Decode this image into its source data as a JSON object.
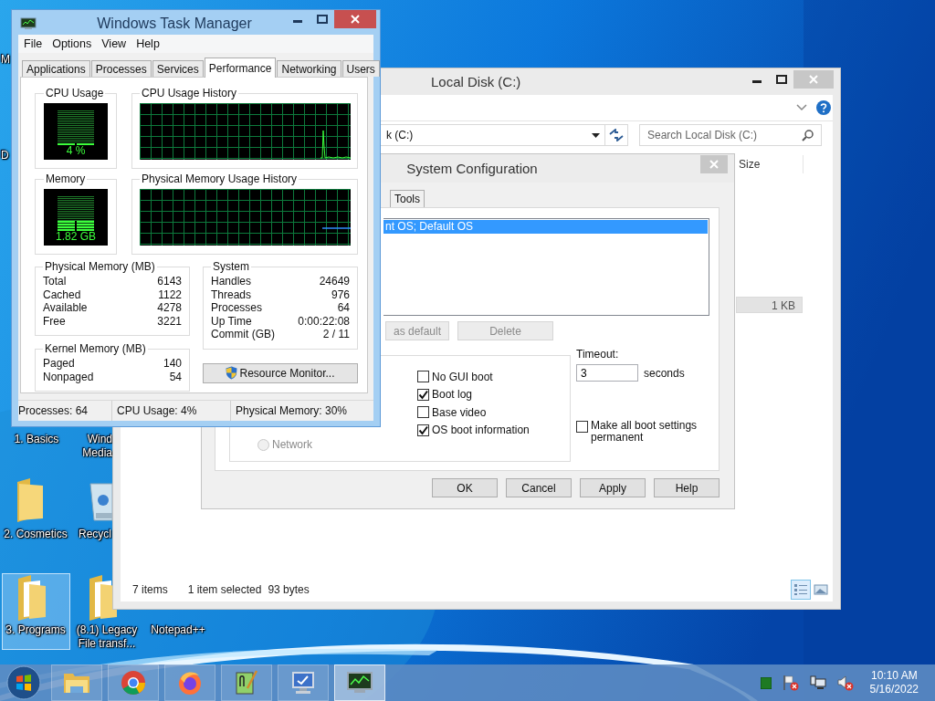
{
  "desktop_icons": [
    {
      "lines": [
        "M"
      ],
      "kind": "none",
      "selected": false
    },
    {
      "lines": [
        "D"
      ],
      "kind": "none",
      "selected": false
    },
    {
      "lines": [
        "1. Basics"
      ],
      "kind": "none",
      "selected": false
    },
    {
      "lines": [
        "Wind",
        "Media"
      ],
      "kind": "none",
      "selected": false
    },
    {
      "lines": [
        "2. Cosmetics"
      ],
      "kind": "folder",
      "selected": false
    },
    {
      "lines": [
        "Recycl"
      ],
      "kind": "recycle-bin",
      "selected": false
    },
    {
      "lines": [
        "3. Programs"
      ],
      "kind": "folder-open",
      "selected": true
    },
    {
      "lines": [
        "(8.1) Legacy",
        "File transf..."
      ],
      "kind": "folder-open",
      "selected": false
    },
    {
      "lines": [
        "Notepad++"
      ],
      "kind": "none",
      "selected": false
    }
  ],
  "explorer": {
    "title": "Local Disk (C:)",
    "address": "k (C:)",
    "search_placeholder": "Search Local Disk (C:)",
    "columns": [
      "Size"
    ],
    "rows": [
      {
        "size": "1 KB",
        "selected": true
      }
    ],
    "status": [
      "7 items",
      "1 item selected",
      "93 bytes"
    ],
    "views": [
      {
        "kind": "details",
        "selected": true
      },
      {
        "kind": "large-icons",
        "selected": false
      }
    ]
  },
  "system_configuration": {
    "title": "System Configuration",
    "tabs": [
      {
        "label": "Tools",
        "selected": false
      }
    ],
    "boot_entries": [
      {
        "label": "nt OS; Default OS",
        "selected": true
      }
    ],
    "entry_buttons": [
      {
        "label": "as default",
        "disabled": true
      },
      {
        "label": "Delete",
        "disabled": true
      }
    ],
    "boot_radios": [
      {
        "label": "Network",
        "selected": false,
        "disabled": true
      }
    ],
    "boot_checkboxes": [
      {
        "label": "No GUI boot",
        "checked": false
      },
      {
        "label": "Boot log",
        "checked": true
      },
      {
        "label": "Base video",
        "checked": false
      },
      {
        "label": "OS boot information",
        "checked": true
      }
    ],
    "timeout": {
      "label": "Timeout:",
      "value": "3",
      "unit": "seconds"
    },
    "make_permanent": {
      "label": "Make all boot settings permanent",
      "checked": false
    },
    "buttons": [
      "OK",
      "Cancel",
      "Apply",
      "Help"
    ]
  },
  "task_manager": {
    "title": "Windows Task Manager",
    "menu": [
      "File",
      "Options",
      "View",
      "Help"
    ],
    "tabs": [
      {
        "label": "Applications",
        "selected": false
      },
      {
        "label": "Processes",
        "selected": false
      },
      {
        "label": "Services",
        "selected": false
      },
      {
        "label": "Performance",
        "selected": true
      },
      {
        "label": "Networking",
        "selected": false
      },
      {
        "label": "Users",
        "selected": false
      }
    ],
    "cpu_usage": {
      "label": "CPU Usage",
      "reading": "4 %"
    },
    "cpu_history": {
      "label": "CPU Usage History"
    },
    "memory": {
      "label": "Memory",
      "reading": "1.82 GB"
    },
    "memory_history": {
      "label": "Physical Memory Usage History"
    },
    "physical_memory": {
      "title": "Physical Memory (MB)",
      "rows": [
        {
          "label": "Total",
          "value": "6143"
        },
        {
          "label": "Cached",
          "value": "1122"
        },
        {
          "label": "Available",
          "value": "4278"
        },
        {
          "label": "Free",
          "value": "3221"
        }
      ]
    },
    "kernel_memory": {
      "title": "Kernel Memory (MB)",
      "rows": [
        {
          "label": "Paged",
          "value": "140"
        },
        {
          "label": "Nonpaged",
          "value": "54"
        }
      ]
    },
    "system": {
      "title": "System",
      "rows": [
        {
          "label": "Handles",
          "value": "24649"
        },
        {
          "label": "Threads",
          "value": "976"
        },
        {
          "label": "Processes",
          "value": "64"
        },
        {
          "label": "Up Time",
          "value": "0:00:22:08"
        },
        {
          "label": "Commit (GB)",
          "value": "2 / 11"
        }
      ]
    },
    "resource_monitor_button": "Resource Monitor...",
    "status_bar": [
      "Processes: 64",
      "CPU Usage: 4%",
      "Physical Memory: 30%"
    ]
  },
  "taskbar": {
    "apps": [
      {
        "kind": "file-explorer",
        "active": false
      },
      {
        "kind": "chrome",
        "active": false
      },
      {
        "kind": "firefox",
        "active": false
      },
      {
        "kind": "notepad",
        "active": false
      },
      {
        "kind": "monitor",
        "active": false
      },
      {
        "kind": "task-manager",
        "active": true
      }
    ],
    "tray": [
      {
        "kind": "square"
      },
      {
        "kind": "flag"
      },
      {
        "kind": "network"
      },
      {
        "kind": "speaker"
      }
    ],
    "time": "10:10 AM",
    "date": "5/16/2022"
  }
}
